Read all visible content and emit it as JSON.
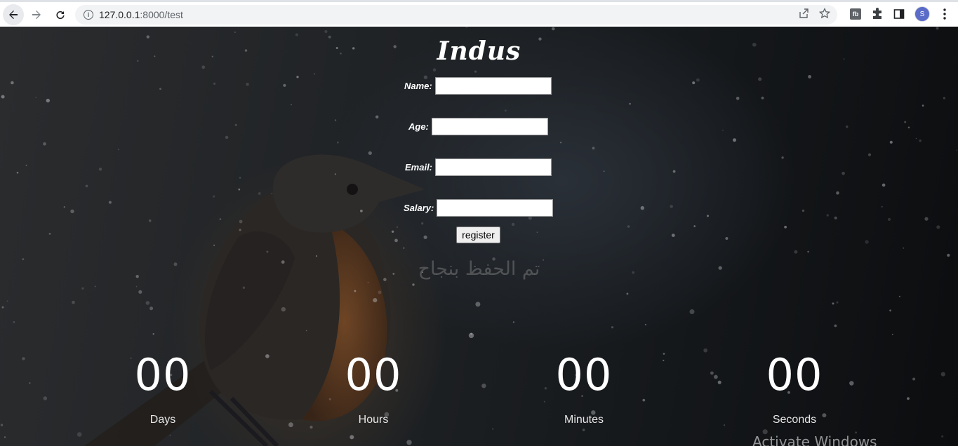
{
  "browser": {
    "url_host": "127.0.0.1",
    "url_path": ":8000/test",
    "extension_label": "fb",
    "avatar_initial": "S"
  },
  "page": {
    "brand": "Indus",
    "form": {
      "fields": [
        {
          "label": "Name:",
          "value": ""
        },
        {
          "label": "Age:",
          "value": ""
        },
        {
          "label": "Email:",
          "value": ""
        },
        {
          "label": "Salary:",
          "value": ""
        }
      ],
      "submit_label": "register"
    },
    "success_message": "تم الحفظ بنجاح",
    "countdown": [
      {
        "value": "00",
        "label": "Days"
      },
      {
        "value": "00",
        "label": "Hours"
      },
      {
        "value": "00",
        "label": "Minutes"
      },
      {
        "value": "00",
        "label": "Seconds"
      }
    ],
    "watermark": "Activate Windows"
  },
  "colors": {
    "accent_avatar": "#5b6bc8",
    "success_text": "#787878"
  }
}
